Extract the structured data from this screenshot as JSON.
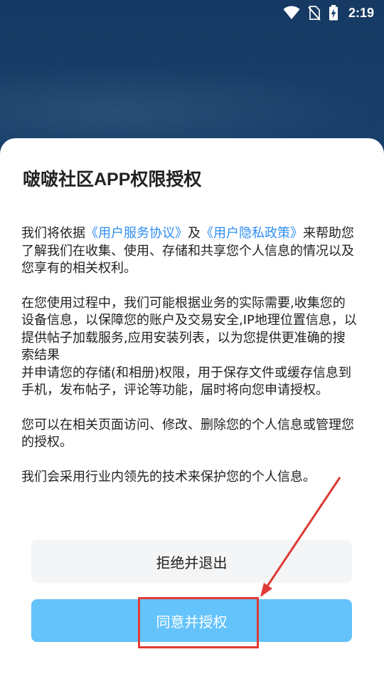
{
  "status_bar": {
    "time": "2:19",
    "icons": [
      "wifi-icon",
      "no-sim-icon",
      "battery-charging-icon"
    ]
  },
  "dialog": {
    "title": "啵啵社区APP权限授权",
    "paragraph1": {
      "prefix": "我们将依据",
      "link1": "《用户服务协议》",
      "middle": "及",
      "link2": "《用户隐私政策》",
      "suffix": "来帮助您了解我们在收集、使用、存储和共享您个人信息的情况以及您享有的相关权利。"
    },
    "paragraph2_line1": "在您使用过程中，我们可能根据业务的实际需要,收集您的设备信息，以保障您的账户及交易安全,IP地理位置信息，以提供帖子加载服务,应用安装列表，以为您提供更准确的搜索结果",
    "paragraph2_line2": "并申请您的存储(和相册)权限，用于保存文件或缓存信息到手机，发布帖子，评论等功能，届时将向您申请授权。",
    "paragraph3": "您可以在相关页面访问、修改、删除您的个人信息或管理您的授权。",
    "paragraph4": "我们会采用行业内领先的技术来保护您的个人信息。",
    "reject_label": "拒绝并退出",
    "agree_label": "同意并授权"
  },
  "colors": {
    "link": "#2f8ef2",
    "agree_button": "#64c3fb",
    "reject_button": "#f4f5f7",
    "annotation": "#e03a35"
  }
}
